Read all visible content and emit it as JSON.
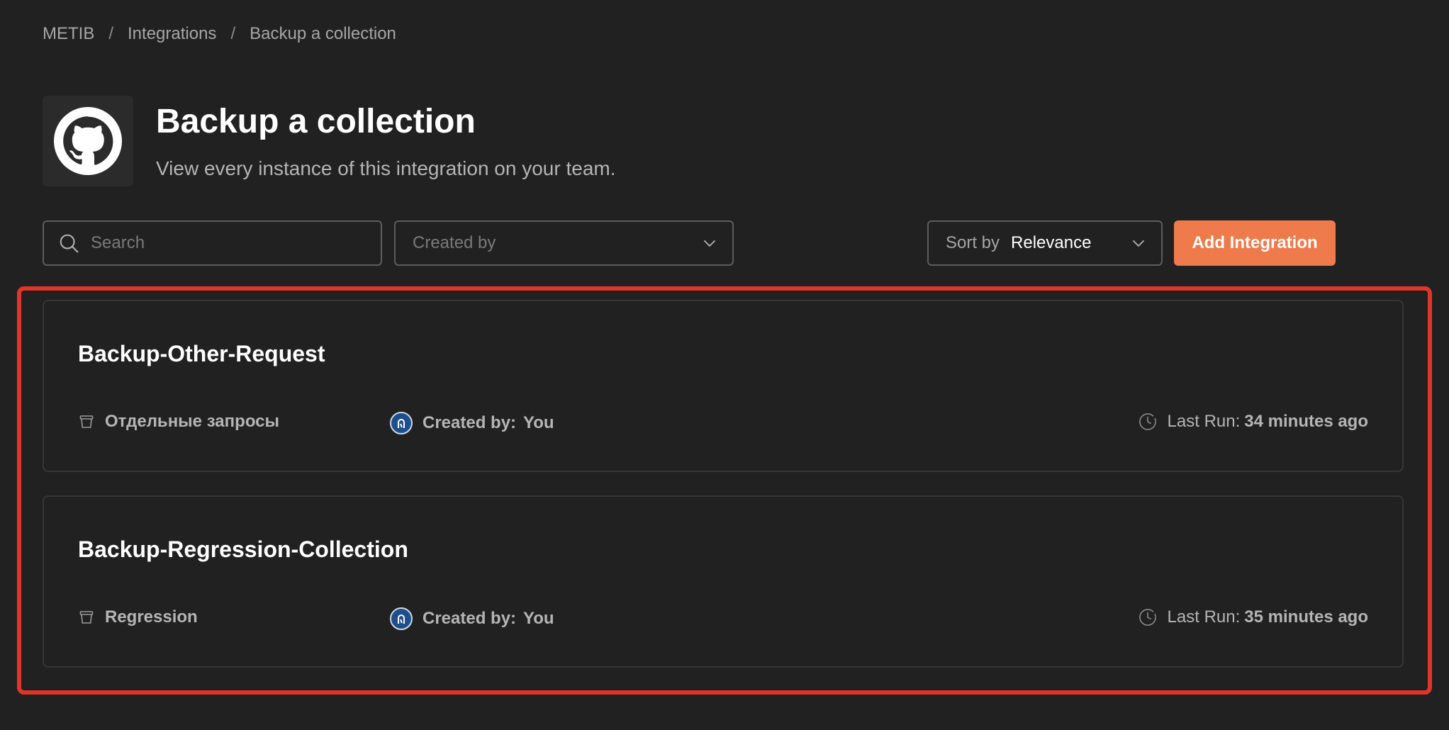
{
  "breadcrumb": {
    "items": [
      "METIB",
      "Integrations",
      "Backup a collection"
    ],
    "separator": "/"
  },
  "header": {
    "logo_icon": "github-icon",
    "title": "Backup a collection",
    "subtitle": "View every instance of this integration on your team."
  },
  "toolbar": {
    "search_placeholder": "Search",
    "search_value": "",
    "created_by_placeholder": "Created by",
    "sort_label": "Sort by",
    "sort_value": "Relevance",
    "add_button_label": "Add Integration"
  },
  "colors": {
    "background": "#212121",
    "accent": "#ef7a4b",
    "highlight": "#e0352a"
  },
  "integrations": [
    {
      "name": "Backup-Other-Request",
      "collection": "Отдельные запросы",
      "created_by_label": "Created by:",
      "created_by_value": "You",
      "last_run_label": "Last Run:",
      "last_run_value": "34 minutes ago"
    },
    {
      "name": "Backup-Regression-Collection",
      "collection": "Regression",
      "created_by_label": "Created by:",
      "created_by_value": "You",
      "last_run_label": "Last Run:",
      "last_run_value": "35 minutes ago"
    }
  ]
}
